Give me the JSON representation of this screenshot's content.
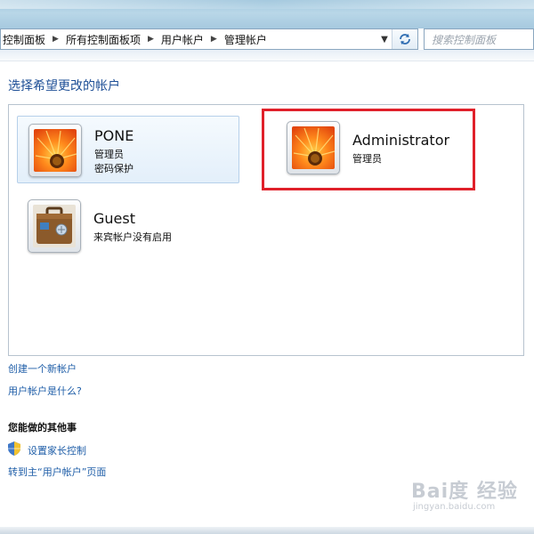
{
  "breadcrumb": {
    "items": [
      "控制面板",
      "所有控制面板项",
      "用户帐户",
      "管理帐户"
    ]
  },
  "search": {
    "placeholder": "搜索控制面板"
  },
  "page_title": "选择希望更改的帐户",
  "accounts": [
    {
      "name": "PONE",
      "lines": [
        "管理员",
        "密码保护"
      ],
      "avatar": "orange-flower-picture"
    },
    {
      "name": "Administrator",
      "lines": [
        "管理员"
      ],
      "avatar": "orange-flower-picture"
    },
    {
      "name": "Guest",
      "lines": [
        "来宾帐户没有启用"
      ],
      "avatar": "suitcase-picture"
    }
  ],
  "links": {
    "create_account": "创建一个新帐户",
    "what_is_account": "用户帐户是什么?"
  },
  "other_tasks": {
    "heading": "您能做的其他事",
    "parental_controls": "设置家长控制",
    "goto_main": "转到主“用户帐户”页面"
  },
  "watermark": {
    "logo": "Bai度 经验",
    "sub": "jingyan.baidu.com"
  },
  "colors": {
    "link": "#1f5ea8",
    "title": "#1e4f96",
    "highlight": "#e0202a"
  }
}
